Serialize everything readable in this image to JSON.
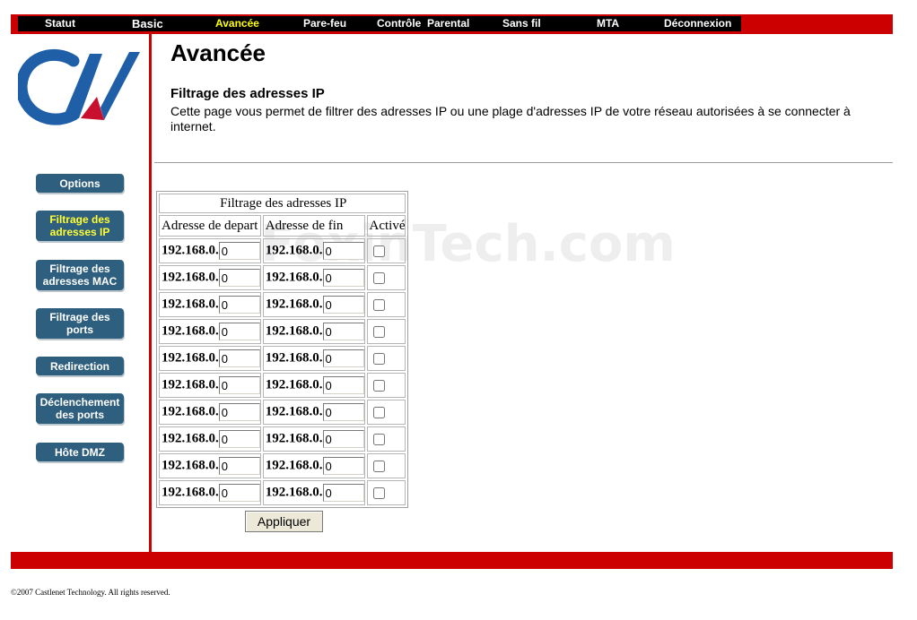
{
  "nav": [
    {
      "label": "Statut",
      "active": false
    },
    {
      "label": "Basic",
      "active": false
    },
    {
      "label": "Avancée",
      "active": true
    },
    {
      "label": "Pare-feu",
      "active": false
    },
    {
      "label": "Contrôle  Parental",
      "active": false
    },
    {
      "label": "Sans fil",
      "active": false
    },
    {
      "label": "MTA",
      "active": false
    },
    {
      "label": "Déconnexion",
      "active": false
    }
  ],
  "sidebar": [
    {
      "label": "Options",
      "active": false
    },
    {
      "label": "Filtrage des adresses IP",
      "active": true
    },
    {
      "label": "Filtrage des adresses MAC",
      "active": false
    },
    {
      "label": "Filtrage des ports",
      "active": false
    },
    {
      "label": "Redirection",
      "active": false
    },
    {
      "label": "Déclenchement des ports",
      "active": false
    },
    {
      "label": "Hôte DMZ",
      "active": false
    }
  ],
  "page": {
    "title": "Avancée",
    "section_title": "Filtrage des adresses IP",
    "description": "Cette page vous permet de filtrer des adresses IP ou une plage d'adresses IP de votre réseau autorisées à se connecter à internet."
  },
  "table": {
    "caption": "Filtrage des adresses IP",
    "headers": [
      "Adresse de depart",
      "Adresse de fin",
      "Activé"
    ],
    "rows": [
      {
        "start_prefix": "192.168.0.",
        "start": "0",
        "end_prefix": "192.168.0.",
        "end": "0",
        "enabled": false
      },
      {
        "start_prefix": "192.168.0.",
        "start": "0",
        "end_prefix": "192.168.0.",
        "end": "0",
        "enabled": false
      },
      {
        "start_prefix": "192.168.0.",
        "start": "0",
        "end_prefix": "192.168.0.",
        "end": "0",
        "enabled": false
      },
      {
        "start_prefix": "192.168.0.",
        "start": "0",
        "end_prefix": "192.168.0.",
        "end": "0",
        "enabled": false
      },
      {
        "start_prefix": "192.168.0.",
        "start": "0",
        "end_prefix": "192.168.0.",
        "end": "0",
        "enabled": false
      },
      {
        "start_prefix": "192.168.0.",
        "start": "0",
        "end_prefix": "192.168.0.",
        "end": "0",
        "enabled": false
      },
      {
        "start_prefix": "192.168.0.",
        "start": "0",
        "end_prefix": "192.168.0.",
        "end": "0",
        "enabled": false
      },
      {
        "start_prefix": "192.168.0.",
        "start": "0",
        "end_prefix": "192.168.0.",
        "end": "0",
        "enabled": false
      },
      {
        "start_prefix": "192.168.0.",
        "start": "0",
        "end_prefix": "192.168.0.",
        "end": "0",
        "enabled": false
      },
      {
        "start_prefix": "192.168.0.",
        "start": "0",
        "end_prefix": "192.168.0.",
        "end": "0",
        "enabled": false
      }
    ]
  },
  "apply_label": "Appliquer",
  "footer": "©2007 Castlenet Technology. All rights reserved.",
  "watermark": "FoxinTech.com",
  "colors": {
    "accent": "#cc0000",
    "nav_bg": "#000000",
    "nav_active": "#ffff00",
    "button_bg": "#2f5f7f",
    "logo_blue": "#1f5fa8",
    "logo_red": "#c8102e"
  }
}
